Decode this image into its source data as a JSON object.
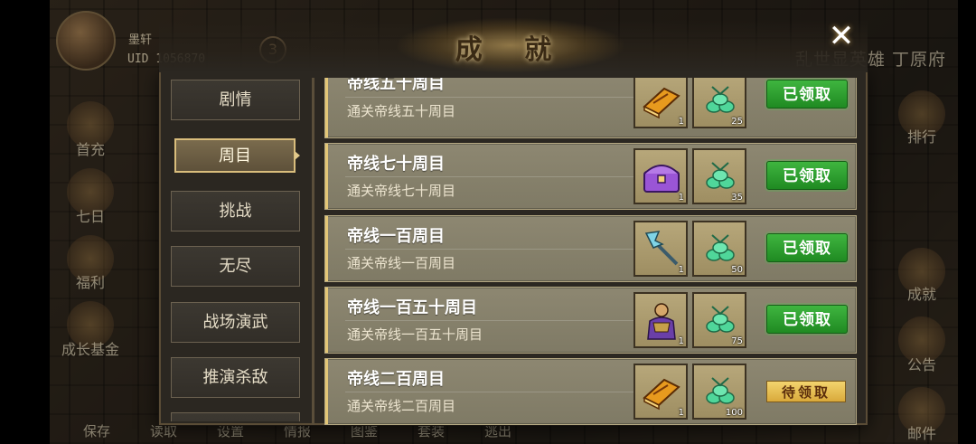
{
  "player": {
    "name": "墨轩",
    "uid": "UID 1056870",
    "vip_level": "3"
  },
  "server_title": "乱世显英雄 丁原府",
  "dialog": {
    "title": "成 就",
    "close_label": "✕"
  },
  "tabs": [
    {
      "label": "剧情",
      "active": false
    },
    {
      "label": "周目",
      "active": true
    },
    {
      "label": "挑战",
      "active": false
    },
    {
      "label": "无尽",
      "active": false
    },
    {
      "label": "战场演武",
      "active": false
    },
    {
      "label": "推演杀敌",
      "active": false
    }
  ],
  "achievements": [
    {
      "title": "帝线五十周目",
      "desc": "通关帝线五十周目",
      "rewards": [
        {
          "icon": "book-icon",
          "count": "1"
        },
        {
          "icon": "jade-ingot-icon",
          "count": "25"
        }
      ],
      "button": "已领取",
      "status": "claimed"
    },
    {
      "title": "帝线七十周目",
      "desc": "通关帝线七十周目",
      "rewards": [
        {
          "icon": "treasure-chest-icon",
          "count": "1"
        },
        {
          "icon": "jade-ingot-icon",
          "count": "35"
        }
      ],
      "button": "已领取",
      "status": "claimed"
    },
    {
      "title": "帝线一百周目",
      "desc": "通关帝线一百周目",
      "rewards": [
        {
          "icon": "halberd-icon",
          "count": "1"
        },
        {
          "icon": "jade-ingot-icon",
          "count": "50"
        }
      ],
      "button": "已领取",
      "status": "claimed"
    },
    {
      "title": "帝线一百五十周目",
      "desc": "通关帝线一百五十周目",
      "rewards": [
        {
          "icon": "general-portrait-icon",
          "count": "1"
        },
        {
          "icon": "jade-ingot-icon",
          "count": "75"
        }
      ],
      "button": "已领取",
      "status": "claimed"
    },
    {
      "title": "帝线二百周目",
      "desc": "通关帝线二百周目",
      "rewards": [
        {
          "icon": "book-icon",
          "count": "1"
        },
        {
          "icon": "jade-ingot-icon",
          "count": "100"
        }
      ],
      "button": "待领取",
      "status": "pending"
    }
  ],
  "left_menu": [
    "首充",
    "七日",
    "福利",
    "成长基金"
  ],
  "right_menu": [
    "排行",
    "成就",
    "公告",
    "邮件"
  ],
  "bottom_bar": [
    "保存",
    "读取",
    "设置",
    "情报",
    "图鉴",
    "套装",
    "逃出"
  ]
}
